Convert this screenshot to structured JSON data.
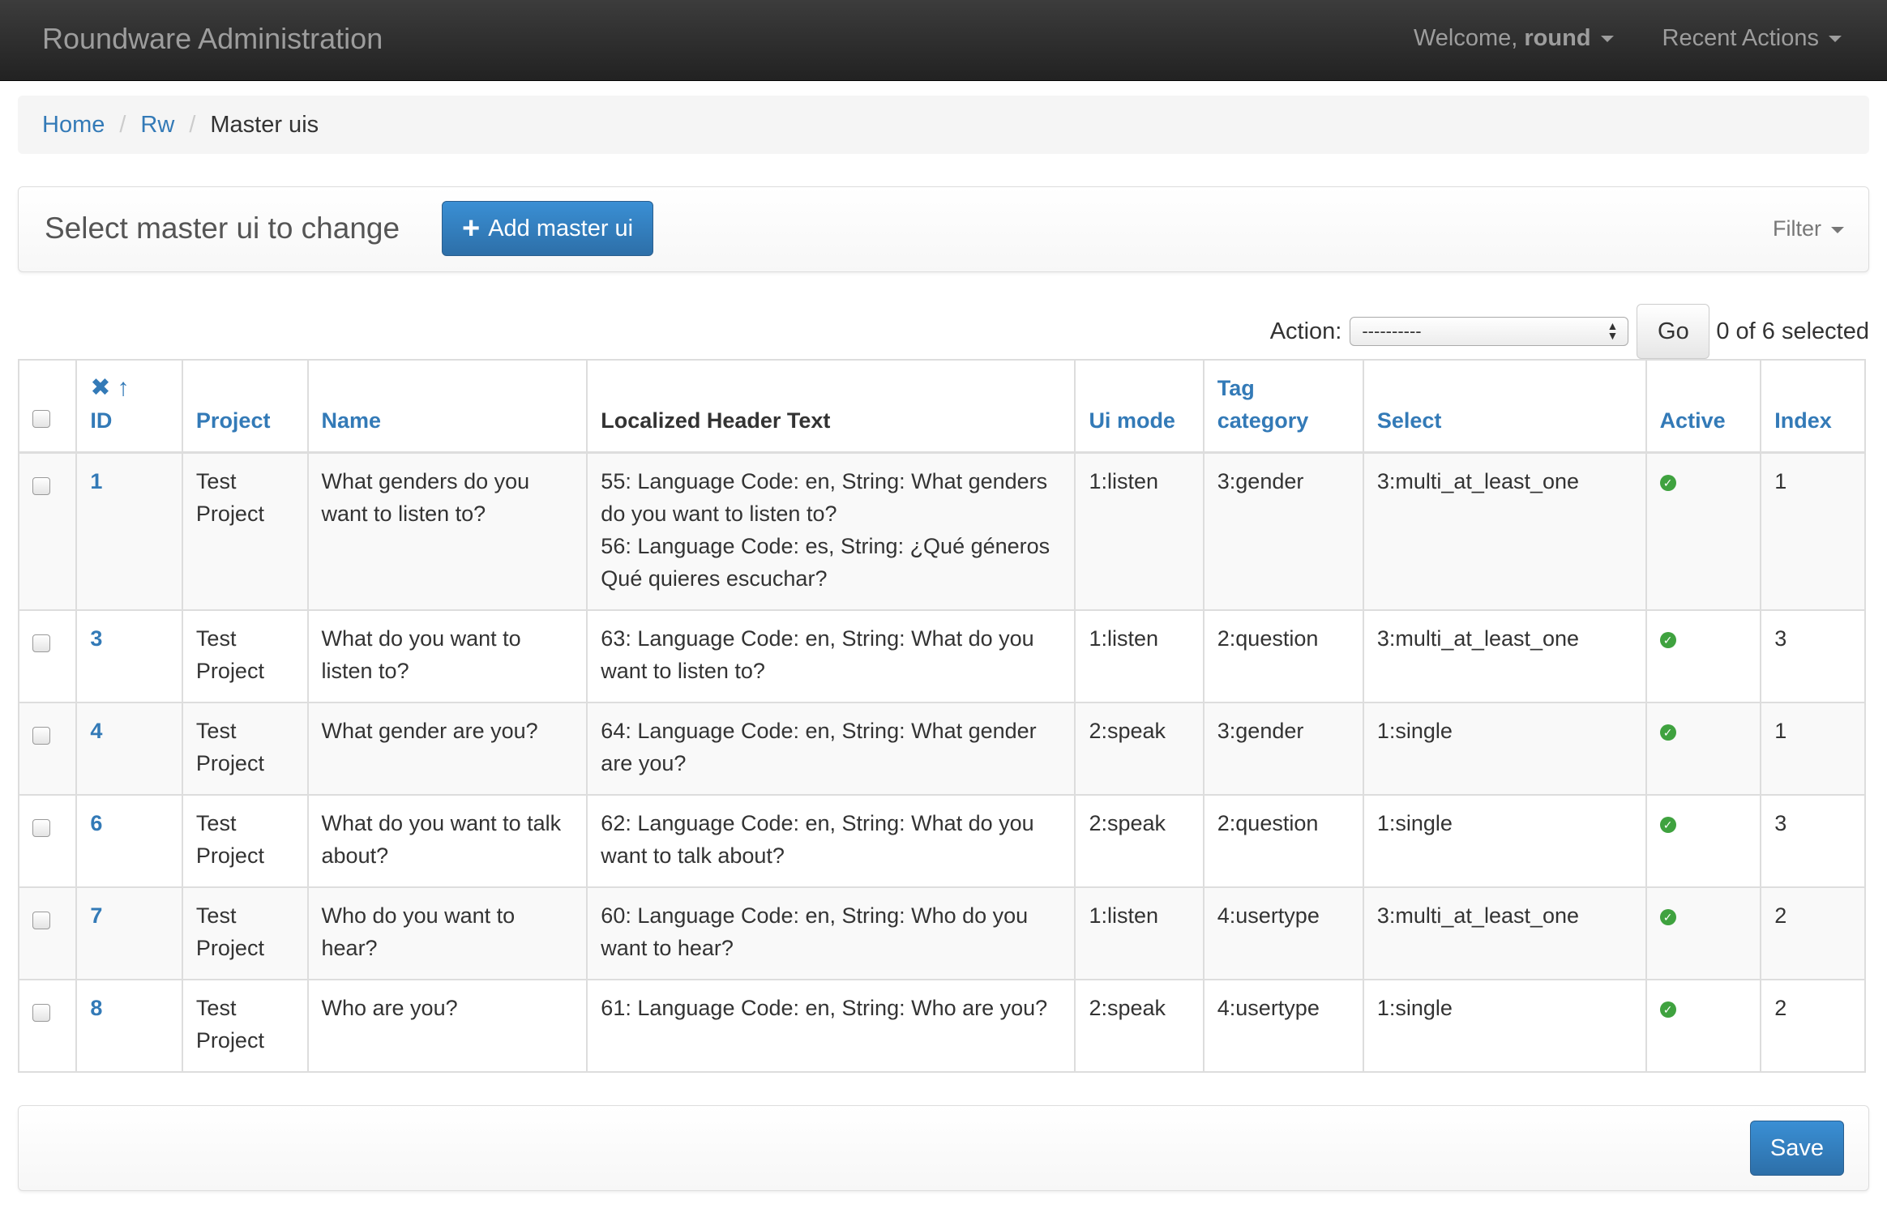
{
  "navbar": {
    "brand": "Roundware Administration",
    "welcome_prefix": "Welcome, ",
    "username": "round",
    "recent_actions": "Recent Actions"
  },
  "breadcrumb": {
    "home": "Home",
    "rw": "Rw",
    "current": "Master uis",
    "separator": "/"
  },
  "header": {
    "title": "Select master ui to change",
    "add_button": "Add master ui",
    "filter": "Filter"
  },
  "actions": {
    "label": "Action:",
    "selected_option": "----------",
    "go": "Go",
    "selection_count": "0 of 6 selected"
  },
  "table": {
    "columns": {
      "id": "ID",
      "project": "Project",
      "name": "Name",
      "localized_header_text": "Localized Header Text",
      "ui_mode": "Ui mode",
      "tag_category": "Tag category",
      "select": "Select",
      "active": "Active",
      "index": "Index"
    },
    "rows": [
      {
        "id": "1",
        "project": "Test Project",
        "name": "What genders do you want to listen to?",
        "header_lines": [
          "55: Language Code: en, String: What genders do you want to listen to?",
          "56: Language Code: es, String: ¿Qué géneros Qué quieres escuchar?"
        ],
        "ui_mode": "1:listen",
        "tag_category": "3:gender",
        "select": "3:multi_at_least_one",
        "active": true,
        "index": "1"
      },
      {
        "id": "3",
        "project": "Test Project",
        "name": "What do you want to listen to?",
        "header_lines": [
          "63: Language Code: en, String: What do you want to listen to?"
        ],
        "ui_mode": "1:listen",
        "tag_category": "2:question",
        "select": "3:multi_at_least_one",
        "active": true,
        "index": "3"
      },
      {
        "id": "4",
        "project": "Test Project",
        "name": "What gender are you?",
        "header_lines": [
          "64: Language Code: en, String: What gender are you?"
        ],
        "ui_mode": "2:speak",
        "tag_category": "3:gender",
        "select": "1:single",
        "active": true,
        "index": "1"
      },
      {
        "id": "6",
        "project": "Test Project",
        "name": "What do you want to talk about?",
        "header_lines": [
          "62: Language Code: en, String: What do you want to talk about?"
        ],
        "ui_mode": "2:speak",
        "tag_category": "2:question",
        "select": "1:single",
        "active": true,
        "index": "3"
      },
      {
        "id": "7",
        "project": "Test Project",
        "name": "Who do you want to hear?",
        "header_lines": [
          "60: Language Code: en, String: Who do you want to hear?"
        ],
        "ui_mode": "1:listen",
        "tag_category": "4:usertype",
        "select": "3:multi_at_least_one",
        "active": true,
        "index": "2"
      },
      {
        "id": "8",
        "project": "Test Project",
        "name": "Who are you?",
        "header_lines": [
          "61: Language Code: en, String: Who are you?"
        ],
        "ui_mode": "2:speak",
        "tag_category": "4:usertype",
        "select": "1:single",
        "active": true,
        "index": "2"
      }
    ]
  },
  "footer": {
    "save": "Save"
  },
  "colors": {
    "navbar": "#222222",
    "link": "#337ab7",
    "primary_button": "#337ab7",
    "active_icon": "#3fa23f"
  },
  "icons": {
    "sort_remove": "close-icon",
    "sort_asc": "arrow-up-icon",
    "active": "check-circle-icon",
    "add": "plus-icon"
  }
}
